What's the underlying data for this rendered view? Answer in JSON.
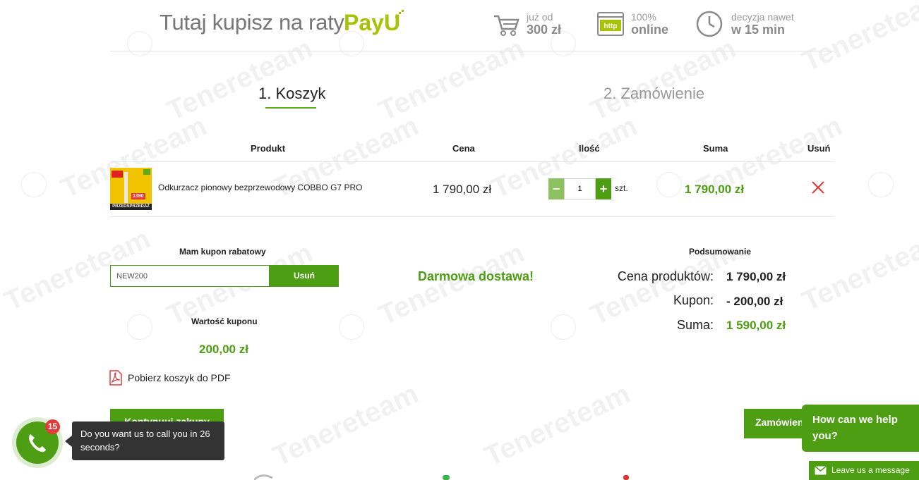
{
  "banner": {
    "title": "Tutaj kupisz na raty",
    "logo": "PayU",
    "features": [
      {
        "icon": "cart-icon",
        "line1": "już od",
        "line2": "300 zł"
      },
      {
        "icon": "http-icon",
        "line1": "100%",
        "line2": "online"
      },
      {
        "icon": "clock-icon",
        "line1": "decyzja nawet",
        "line2": "w 15 min"
      }
    ]
  },
  "steps": [
    {
      "label": "1. Koszyk",
      "active": true
    },
    {
      "label": "2. Zamówienie",
      "active": false
    }
  ],
  "table": {
    "headers": [
      "Produkt",
      "Cena",
      "Ilość",
      "Suma",
      "Usuń"
    ],
    "rows": [
      {
        "thumb_price": "1390",
        "thumb_banner": "PRZEDSPRZEDAŻ",
        "name": "Odkurzacz pionowy bezprzewodowy COBBO G7 PRO",
        "price": "1 790,00 zł",
        "quantity": "1",
        "unit": "szt.",
        "sum": "1 790,00 zł"
      }
    ]
  },
  "coupon": {
    "heading": "Mam kupon rabatowy",
    "code": "NEW200",
    "remove_label": "Usuń",
    "value_heading": "Wartość kuponu",
    "value": "200,00 zł"
  },
  "pdf_link": "Pobierz koszyk do PDF",
  "free_shipping": "Darmowa dostawa!",
  "summary": {
    "heading": "Podsumowanie",
    "rows": [
      {
        "label": "Cena produktów:",
        "value": "1 790,00 zł"
      },
      {
        "label": "Kupon:",
        "value": "- 200,00 zł"
      },
      {
        "label": "Suma:",
        "value": "1 590,00 zł"
      }
    ]
  },
  "buttons": {
    "continue": "Kontynuuj zakupy",
    "order": "Zamówienie"
  },
  "call_widget": {
    "badge": "15",
    "tooltip": "Do you want us to call you in 26 seconds?"
  },
  "chat_widget": {
    "prompt": "How can we help you?",
    "leave_message": "Leave us a message"
  },
  "watermark": "Tenereteam",
  "colors": {
    "accent": "#4d9e12",
    "payu": "#a6c307",
    "remove": "#e23b3b"
  }
}
